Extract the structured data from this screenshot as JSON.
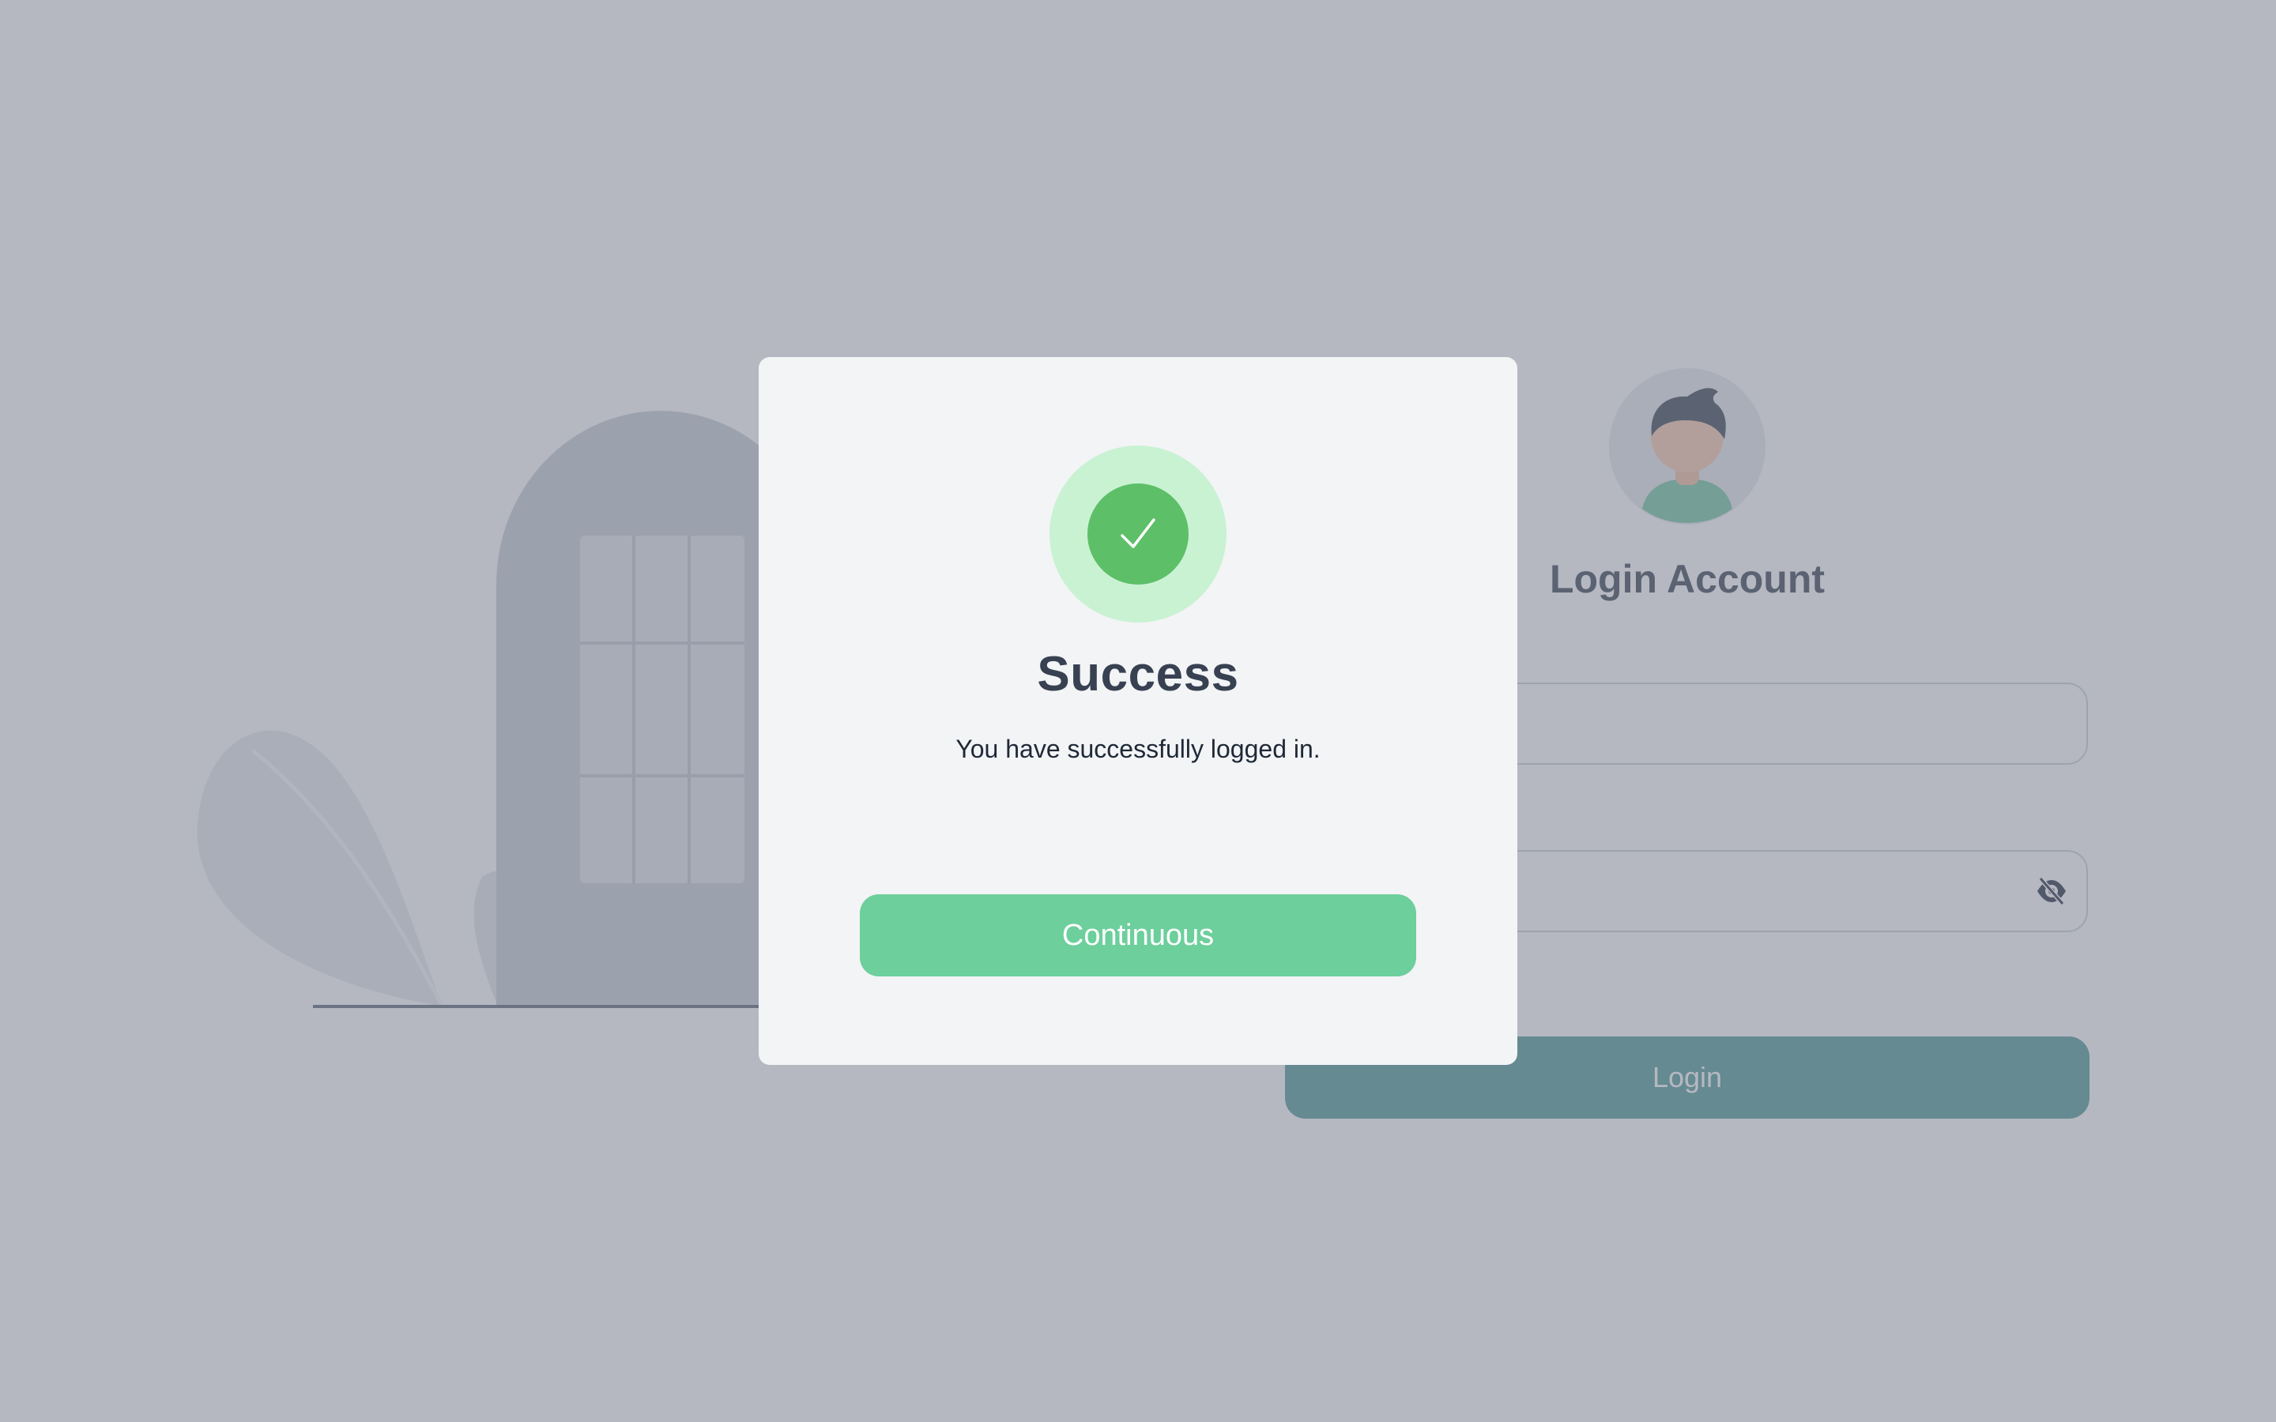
{
  "login": {
    "title": "Login Account",
    "email_label": "",
    "email_value": "",
    "password_label": "",
    "password_value": "",
    "login_button": "Login",
    "password_toggle_icon": "eye-slash-icon",
    "avatar_icon": "user-avatar-icon"
  },
  "illustration": {
    "icons": [
      "door-icon",
      "leaf-icon"
    ]
  },
  "modal": {
    "icon": "checkmark-icon",
    "title": "Success",
    "message": "You have successfully logged in.",
    "button": "Continuous"
  },
  "colors": {
    "overlay": "#6b7284",
    "modal_background": "#f3f4f6",
    "success_green": "#5dbf68",
    "success_ring": "#c9f2d3",
    "continue_button": "#6ccf9c",
    "login_button": "#5fa39e"
  }
}
